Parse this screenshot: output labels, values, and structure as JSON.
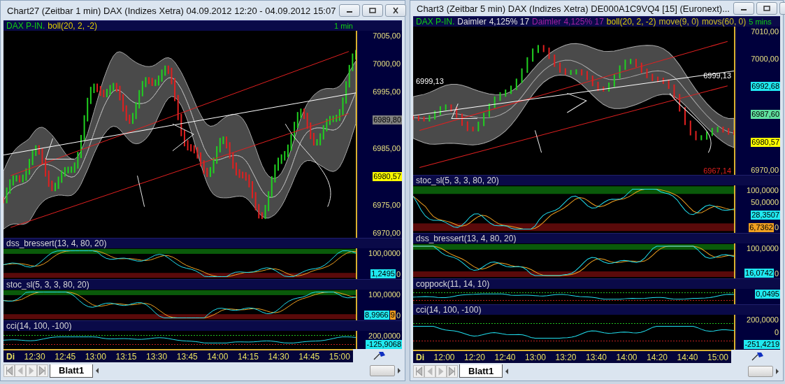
{
  "windows": [
    {
      "title": "Chart27 (Zeitbar 1 min)  DAX (Indizes Xetra) 04.09.2012 12:20 - 04.09.2012 15:07",
      "panes": [
        {
          "kind": "price",
          "legend": [
            {
              "text": "DAX P-IN.",
              "color": "#10d010"
            },
            {
              "text": "boll(20, 2, -2)",
              "color": "#e0d000"
            }
          ],
          "timeframe": "1 min",
          "axis": [
            [
              {
                "kind": "tick",
                "text": "7005,00"
              }
            ],
            [
              {
                "kind": "tick",
                "text": "7000,00"
              }
            ],
            [
              {
                "kind": "tick",
                "text": "6995,00"
              }
            ],
            [
              {
                "kind": "badge",
                "text": "6989,80",
                "color": "#808080"
              }
            ],
            [
              {
                "kind": "tick",
                "text": "6985,00"
              }
            ],
            [
              {
                "kind": "badge",
                "text": "6980,57",
                "color": "#ffff00"
              }
            ],
            [
              {
                "kind": "tick",
                "text": "6975,00"
              }
            ],
            [
              {
                "kind": "tick",
                "text": "6970,00"
              }
            ]
          ]
        },
        {
          "kind": "dss",
          "legend": [
            {
              "text": "dss_bressert(13, 4, 80, 20)"
            }
          ],
          "axis": [
            [
              {
                "kind": "tick",
                "text": "100,0000"
              }
            ],
            [
              {
                "kind": "badge",
                "text": "1,2495",
                "color": "#20e8f0"
              },
              {
                "kind": "tick",
                "text": "0"
              }
            ]
          ]
        },
        {
          "kind": "stoc",
          "legend": [
            {
              "text": "stoc_sl(5, 3, 3, 80, 20)"
            }
          ],
          "axis": [
            [
              {
                "kind": "tick",
                "text": "100,0000"
              }
            ],
            [
              {
                "kind": "badge",
                "text": "8,9966",
                "color": "#20e8f0"
              },
              {
                "kind": "badge",
                "text": "9",
                "color": "#f0a020"
              },
              {
                "kind": "tick",
                "text": "0"
              }
            ]
          ]
        },
        {
          "kind": "cci",
          "legend": [
            {
              "text": "cci(14, 100, -100)"
            }
          ],
          "axis": [
            [
              {
                "kind": "tick",
                "text": "200,0000"
              }
            ],
            [
              {
                "kind": "badge",
                "text": "-125,9068",
                "color": "#20e8f0"
              }
            ]
          ]
        }
      ],
      "time_axis": {
        "day": "Di",
        "ticks": [
          "12:30",
          "12:45",
          "13:00",
          "13:15",
          "13:30",
          "13:45",
          "14:00",
          "14:15",
          "14:30",
          "14:45",
          "15:00"
        ]
      },
      "sheet_tab": {
        "label": "Blatt1",
        "selected": true
      }
    },
    {
      "title": "Chart3 (Zeitbar 5 min)  DAX (Indizes Xetra) DE000A1C9VQ4 [15] (Euronext)...",
      "panes": [
        {
          "kind": "price",
          "legend": [
            {
              "text": "DAX P-IN.",
              "color": "#10d010"
            },
            {
              "text": "Daimler",
              "color": "#e0e0e0"
            },
            {
              "text": "4,125% 17",
              "color": "#e0e0e0"
            },
            {
              "text": "Daimler",
              "color": "#a020a0"
            },
            {
              "text": "4,125% 17",
              "color": "#a020a0"
            },
            {
              "text": "boll(20, 2, -2)",
              "color": "#e0d000"
            },
            {
              "text": "move(9, 0)",
              "color": "#d0c020"
            },
            {
              "text": "movs(60, 0)",
              "color": "#d0c020"
            }
          ],
          "timeframe": "5 mins",
          "plot_labels": [
            {
              "text": "6999,13",
              "color": "#ffffff"
            },
            {
              "text": "6999,13",
              "color": "#ffffff"
            },
            {
              "text": "6967,14",
              "color": "#e02020"
            }
          ],
          "axis": [
            [
              {
                "kind": "tick",
                "text": "7010,00"
              }
            ],
            [
              {
                "kind": "tick",
                "text": "7000,00"
              }
            ],
            [
              {
                "kind": "badge",
                "text": "6992,68",
                "color": "#20e8f0"
              }
            ],
            [
              {
                "kind": "badge",
                "text": "6987,60",
                "color": "#60e0a0"
              }
            ],
            [
              {
                "kind": "badge",
                "text": "6980,57",
                "color": "#ffff00"
              }
            ],
            [
              {
                "kind": "tick",
                "text": "6970,00"
              }
            ]
          ]
        },
        {
          "kind": "stoc",
          "legend": [
            {
              "text": "stoc_sl(5, 3, 3, 80, 20)"
            }
          ],
          "axis": [
            [
              {
                "kind": "tick",
                "text": "100,0000"
              }
            ],
            [
              {
                "kind": "tick",
                "text": "50,0000"
              }
            ],
            [
              {
                "kind": "badge",
                "text": "28,3507",
                "color": "#20e8f0"
              }
            ],
            [
              {
                "kind": "badge",
                "text": "6,7362",
                "color": "#f0a020"
              },
              {
                "kind": "tick",
                "text": "0"
              }
            ]
          ]
        },
        {
          "kind": "dss",
          "legend": [
            {
              "text": "dss_bressert(13, 4, 80, 20)"
            }
          ],
          "axis": [
            [
              {
                "kind": "tick",
                "text": "100,0000"
              }
            ],
            [
              {
                "kind": "badge",
                "text": "16,0742",
                "color": "#20e8f0"
              },
              {
                "kind": "tick",
                "text": "0"
              }
            ]
          ]
        },
        {
          "kind": "coppock",
          "legend": [
            {
              "text": "coppock(11, 14, 10)"
            }
          ],
          "axis": [
            [
              {
                "kind": "badge",
                "text": "0,0495",
                "color": "#20e8f0"
              }
            ]
          ]
        },
        {
          "kind": "cci",
          "legend": [
            {
              "text": "cci(14, 100, -100)"
            }
          ],
          "axis": [
            [
              {
                "kind": "tick",
                "text": "200,0000"
              }
            ],
            [
              {
                "kind": "tick",
                "text": "0"
              }
            ],
            [
              {
                "kind": "badge",
                "text": "-251,4219",
                "color": "#20e8f0"
              }
            ]
          ]
        }
      ],
      "time_axis": {
        "day": "Di",
        "ticks": [
          "12:00",
          "12:20",
          "12:40",
          "13:00",
          "13:20",
          "13:40",
          "14:00",
          "14:20",
          "14:40",
          "15:00"
        ]
      },
      "sheet_tab": {
        "label": "Blatt1",
        "selected": true
      }
    }
  ]
}
